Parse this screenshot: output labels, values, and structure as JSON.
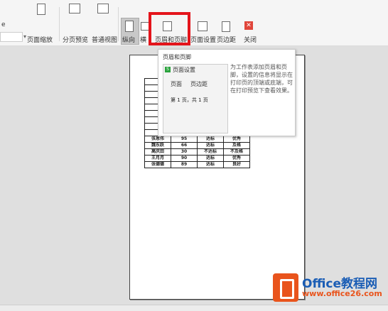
{
  "toolbar": {
    "left_fragment": "e",
    "zoom_label": "页面缩放",
    "page_break_preview": "分页预览",
    "normal_view": "普通视图",
    "portrait": "纵向",
    "landscape_fragment": "横",
    "header_footer": "页眉和页脚",
    "page_setup": "页面设置",
    "page_margin": "页边距",
    "close": "关闭",
    "close_color": "#e0453a"
  },
  "tooltip": {
    "title": "页眉和页脚",
    "preview_heading": "页面设置",
    "tab_page": "页面",
    "tab_margin": "页边距",
    "preview_text": "第 1 页，共 1 页",
    "description": "为工作表添加页眉和页脚，设置的信息将显示在打印页的顶端或底端，可在打印预览下查看效果。"
  },
  "sheet": {
    "rows": [
      [
        "张恩伟",
        "95",
        "达标",
        "优秀"
      ],
      [
        "魏东跃",
        "66",
        "达标",
        "及格"
      ],
      [
        "高庆田",
        "30",
        "不达标",
        "不及格"
      ],
      [
        "王月月",
        "90",
        "达标",
        "优秀"
      ],
      [
        "张德德",
        "89",
        "达标",
        "良好"
      ]
    ]
  },
  "watermark": {
    "brand": "Office教程网",
    "url": "www.office26.com",
    "brand_color": "#1a5db5",
    "accent_color": "#e9541c"
  },
  "highlight_color": "#e4141b"
}
